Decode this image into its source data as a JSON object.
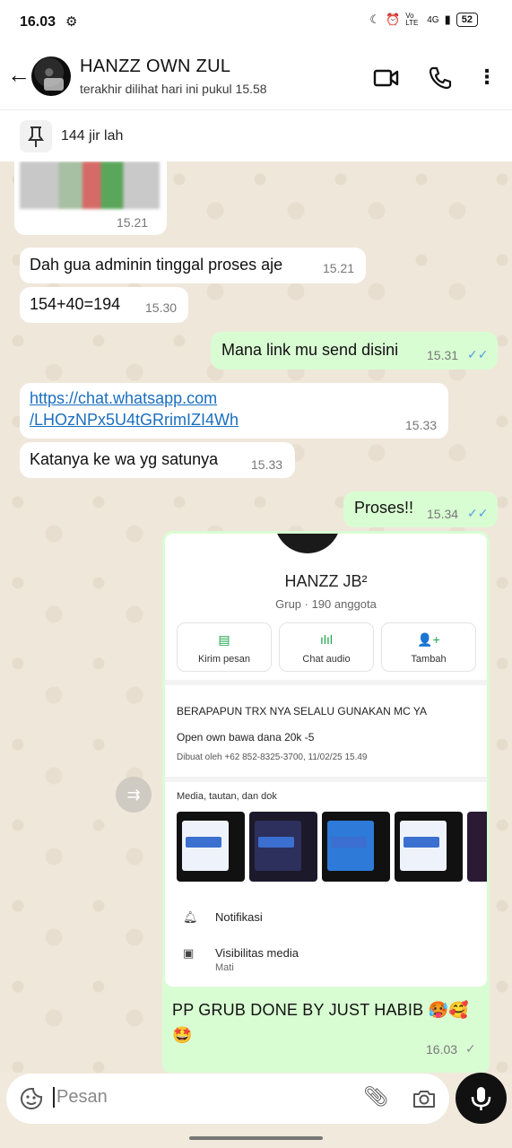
{
  "status_bar": {
    "time": "16.03",
    "signal": "Vo LTE",
    "network": "4G",
    "battery": "52"
  },
  "header": {
    "contact_name": "HANZZ OWN ZUL",
    "last_seen": "terakhir dilihat hari ini pukul 15.58"
  },
  "pinned": {
    "label": "144 jir lah"
  },
  "messages": [
    {
      "type": "image",
      "time": "15.21"
    },
    {
      "type": "in",
      "text": "Dah gua adminin tinggal proses aje",
      "time": "15.21"
    },
    {
      "type": "in",
      "text": "154+40=194",
      "time": "15.30"
    },
    {
      "type": "out",
      "text": "Mana link mu send disini",
      "time": "15.31",
      "ticks": "✓✓"
    },
    {
      "type": "in",
      "link_line1": "https://chat.whatsapp.com",
      "link_line2": "/LHOzNPx5U4tGRrimIZI4Wh",
      "time": "15.33"
    },
    {
      "type": "in",
      "text": "Katanya ke wa yg satunya",
      "time": "15.33"
    },
    {
      "type": "out",
      "text": "Proses!!",
      "time": "15.34",
      "ticks": "✓✓"
    }
  ],
  "forwarded_card": {
    "group_name": "HANZZ JB²",
    "group_sub": "Grup · 190 anggota",
    "actions": [
      "Kirim pesan",
      "Chat audio",
      "Tambah"
    ],
    "description": "BERAPAPUN TRX NYA SELALU GUNAKAN MC YA",
    "description2": "Open own bawa dana 20k -5",
    "created_by": "Dibuat oleh +62 852-8325-3700, 11/02/25 15.49",
    "media_title": "Media, tautan, dan dok",
    "settings": [
      {
        "label": "Notifikasi",
        "sub": ""
      },
      {
        "label": "Visibilitas media",
        "sub": "Mati"
      }
    ],
    "caption_line1": "PP GRUB DONE BY JUST HABIB 🥵🥰",
    "caption_line2": "🤩",
    "time": "16.03",
    "ticks": "✓"
  },
  "input": {
    "placeholder": "Pesan"
  },
  "colors": {
    "outgoing": "#d9fdd3",
    "incoming": "#ffffff",
    "accent": "#1ba34a",
    "link": "#1b6fbf"
  }
}
